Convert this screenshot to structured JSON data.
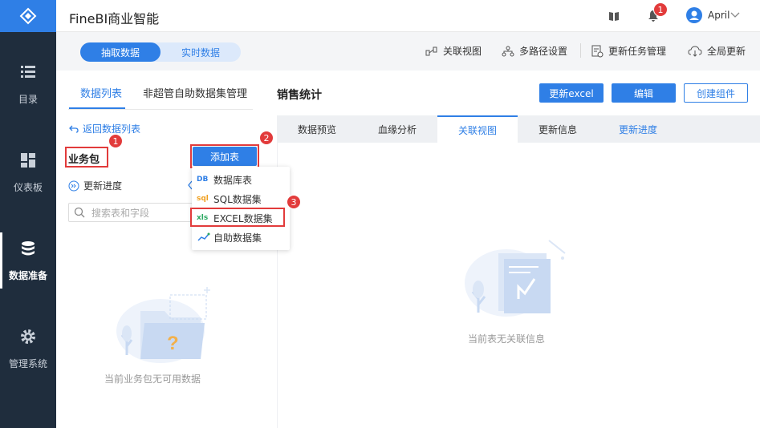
{
  "app": {
    "title": "FineBI商业智能",
    "user": "April",
    "notification_count": "1"
  },
  "nav": [
    {
      "label": "目录",
      "icon": "list-icon"
    },
    {
      "label": "仪表板",
      "icon": "dashboard-icon"
    },
    {
      "label": "数据准备",
      "icon": "database-icon"
    },
    {
      "label": "管理系统",
      "icon": "gear-icon"
    }
  ],
  "mode": {
    "extract": "抽取数据",
    "realtime": "实时数据"
  },
  "tools": {
    "relation_view": "关联视图",
    "multipath": "多路径设置",
    "task_mgmt": "更新任务管理",
    "global_update": "全局更新"
  },
  "left": {
    "tab_list": "数据列表",
    "tab_manage": "非超管自助数据集管理",
    "back": "返回数据列表",
    "package": "业务包",
    "add_table": "添加表",
    "update_progress": "更新进度",
    "search_placeholder": "搜索表和字段",
    "empty_text": "当前业务包无可用数据"
  },
  "dropdown": [
    {
      "icon": "DB",
      "label": "数据库表",
      "color": "#2f7fe6"
    },
    {
      "icon": "sql",
      "label": "SQL数据集",
      "color": "#f0a020"
    },
    {
      "icon": "xls",
      "label": "EXCEL数据集",
      "color": "#2aa860"
    },
    {
      "icon": "~",
      "label": "自助数据集",
      "color": "#2f7fe6"
    }
  ],
  "right": {
    "title": "销售统计",
    "btn_update_excel": "更新excel",
    "btn_edit": "编辑",
    "btn_create": "创建组件",
    "tabs": [
      "数据预览",
      "血缘分析",
      "关联视图",
      "更新信息",
      "更新进度"
    ],
    "empty_text": "当前表无关联信息"
  },
  "steps": [
    "1",
    "2",
    "3"
  ]
}
